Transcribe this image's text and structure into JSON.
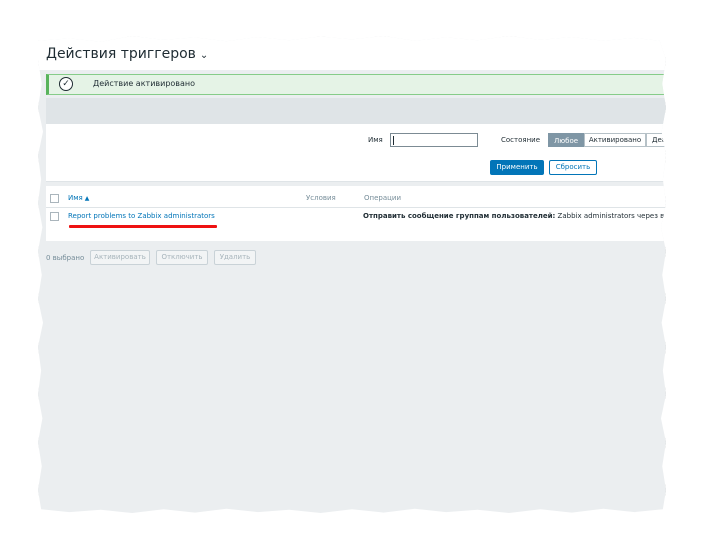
{
  "header": {
    "title": "Действия триггеров",
    "chevron_icon": "chevron-down-icon"
  },
  "message": {
    "text": "Действие активировано",
    "icon": "check-circle-icon"
  },
  "filter": {
    "name_label": "Имя",
    "name_value": "",
    "state_label": "Состояние",
    "state_options": [
      "Любое",
      "Активировано",
      "Деактивировано"
    ],
    "state_selected": "Любое",
    "apply_label": "Применить",
    "reset_label": "Сбросить"
  },
  "table": {
    "columns": {
      "name": "Имя",
      "conditions": "Условия",
      "operations": "Операции"
    },
    "sort_indicator": "▲",
    "rows": [
      {
        "name": "Report problems to Zabbix administrators",
        "conditions": "",
        "operations_bold": "Отправить сообщение группам пользователей:",
        "operations_text": " Zabbix administrators через все способы оповещения"
      }
    ]
  },
  "footer": {
    "selected_count": "0 выбрано",
    "enable_label": "Активировать",
    "disable_label": "Отключить",
    "delete_label": "Удалить"
  },
  "colors": {
    "accent": "#0275b8",
    "success_bg": "#e5f3e6",
    "success_border": "#59b35c",
    "highlight_underline": "#ee1111"
  }
}
